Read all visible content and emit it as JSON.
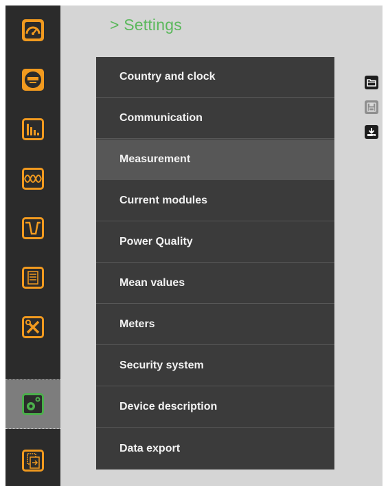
{
  "breadcrumb": {
    "title": "> Settings"
  },
  "sidebar": {
    "items": [
      {
        "icon": "gauge-icon",
        "active": false
      },
      {
        "icon": "meter-display-icon",
        "active": false
      },
      {
        "icon": "bar-chart-icon",
        "active": false
      },
      {
        "icon": "waveform-icon",
        "active": false
      },
      {
        "icon": "dip-curve-icon",
        "active": false
      },
      {
        "icon": "list-document-icon",
        "active": false
      },
      {
        "icon": "tools-icon",
        "active": false
      },
      {
        "icon": "settings-gears-icon",
        "active": true
      },
      {
        "icon": "document-export-icon",
        "active": false
      }
    ]
  },
  "menu": {
    "items": [
      {
        "label": "Country and clock",
        "selected": false
      },
      {
        "label": "Communication",
        "selected": false
      },
      {
        "label": "Measurement",
        "selected": true
      },
      {
        "label": "Current modules",
        "selected": false
      },
      {
        "label": "Power Quality",
        "selected": false
      },
      {
        "label": "Mean values",
        "selected": false
      },
      {
        "label": "Meters",
        "selected": false
      },
      {
        "label": "Security system",
        "selected": false
      },
      {
        "label": "Device description",
        "selected": false
      },
      {
        "label": "Data export",
        "selected": false
      }
    ]
  },
  "toolbar": {
    "buttons": [
      {
        "icon": "open-folder-icon",
        "enabled": true
      },
      {
        "icon": "save-disk-icon",
        "enabled": false
      },
      {
        "icon": "download-icon",
        "enabled": true
      }
    ]
  },
  "colors": {
    "accent_orange": "#f19a1f",
    "accent_green": "#5bb85c",
    "sidebar_bg": "#2b2b2b",
    "menu_bg": "#3b3b3b",
    "menu_selected_bg": "#575757",
    "page_bg": "#d5d5d5"
  }
}
